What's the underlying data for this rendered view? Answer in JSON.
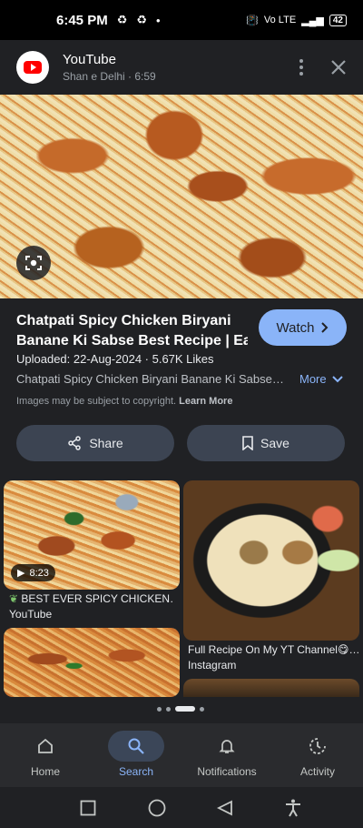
{
  "status_bar": {
    "time": "6:45 PM",
    "network": "Vo LTE",
    "battery": "42"
  },
  "header": {
    "app_name": "YouTube",
    "subtitle": "Shan e Delhi · 6:59"
  },
  "result": {
    "title_line1": "Chatpati Spicy Chicken Biryani",
    "title_line2": "Banane Ki Sabse Best Recipe | Eas…",
    "watch_label": "Watch",
    "meta": "Uploaded: 22-Aug-2024 · 5.67K Likes",
    "description": "Chatpati Spicy Chicken Biryani Banane Ki Sabse…",
    "more_label": "More",
    "copyright_text": "Images may be subject to copyright.",
    "learn_more": "Learn More",
    "share_label": "Share",
    "save_label": "Save"
  },
  "related": [
    {
      "caption": "BEST EVER SPICY CHICKEN…",
      "source": "YouTube",
      "duration": "8:23"
    },
    {
      "caption": "Full Recipe On My YT Channel😋…",
      "source": "Instagram"
    }
  ],
  "bottom_nav": [
    {
      "label": "Home"
    },
    {
      "label": "Search",
      "active": true
    },
    {
      "label": "Notifications"
    },
    {
      "label": "Activity"
    }
  ],
  "colors": {
    "accent": "#8ab4f8",
    "background": "#202124",
    "button": "#3c4452"
  }
}
